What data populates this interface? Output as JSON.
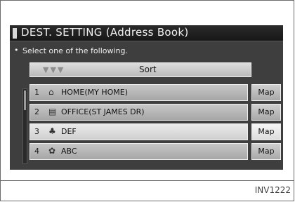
{
  "title": "DEST. SETTING (Address Book)",
  "instruction": "Select one of the following.",
  "bullet": "•",
  "sort": {
    "arrows": "▼▼▼",
    "label": "Sort"
  },
  "rows": [
    {
      "number": "1",
      "icon": "house-icon",
      "glyph": "⌂",
      "label": "HOME(MY HOME)",
      "map_label": "Map"
    },
    {
      "number": "2",
      "icon": "office-icon",
      "glyph": "▤",
      "label": "OFFICE(ST JAMES DR)",
      "map_label": "Map"
    },
    {
      "number": "3",
      "icon": "tree-icon",
      "glyph": "♣",
      "label": "DEF",
      "map_label": "Map"
    },
    {
      "number": "4",
      "icon": "flower-icon",
      "glyph": "✿",
      "label": "ABC",
      "map_label": "Map"
    }
  ],
  "caption": "INV1222"
}
